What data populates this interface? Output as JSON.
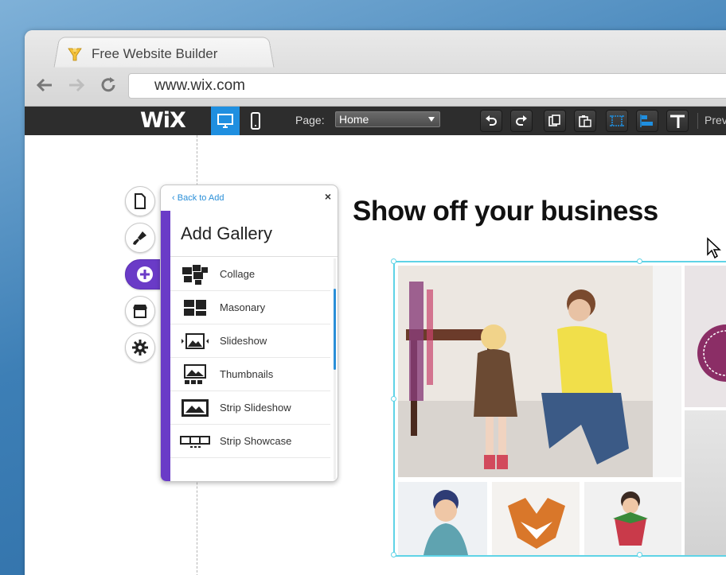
{
  "browser": {
    "tab_title": "Free Website Builder",
    "url": "www.wix.com"
  },
  "editor_bar": {
    "logo": "WiX",
    "page_label": "Page:",
    "page_select_value": "Home",
    "preview_label": "Prev"
  },
  "panel": {
    "back_link": "Back to Add",
    "close": "×",
    "title": "Add Gallery",
    "items": [
      {
        "label": "Collage",
        "icon": "collage-icon"
      },
      {
        "label": "Masonary",
        "icon": "masonry-icon"
      },
      {
        "label": "Slideshow",
        "icon": "slideshow-icon"
      },
      {
        "label": "Thumbnails",
        "icon": "thumbnails-icon"
      },
      {
        "label": "Strip Slideshow",
        "icon": "strip-slideshow-icon"
      },
      {
        "label": "Strip Showcase",
        "icon": "strip-showcase-icon"
      }
    ]
  },
  "content": {
    "headline": "Show off your business"
  },
  "colors": {
    "accent_purple": "#6a3bc7",
    "accent_blue": "#1f8fe0",
    "selection_cyan": "#5fd3e6"
  }
}
